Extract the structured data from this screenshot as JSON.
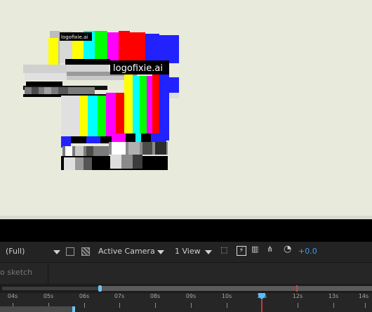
{
  "canvas": {
    "background": "#e8eadb"
  },
  "overlay_labels": {
    "small": "logofixie.ai",
    "large": "logofixie.ai"
  },
  "toolbar": {
    "resolution": "(Full)",
    "camera": "Active Camera",
    "views": "1 View",
    "exposure": "+0.0"
  },
  "panel": {
    "sketch": "o sketch"
  },
  "timeline": {
    "ticks": [
      "04s",
      "05s",
      "06s",
      "07s",
      "08s",
      "09s",
      "10s",
      "11s",
      "12s",
      "13s",
      "14s"
    ]
  },
  "colors": {
    "accent": "#3f9ce8",
    "playhead": "#55bfff",
    "current_time_line": "#d63333"
  }
}
